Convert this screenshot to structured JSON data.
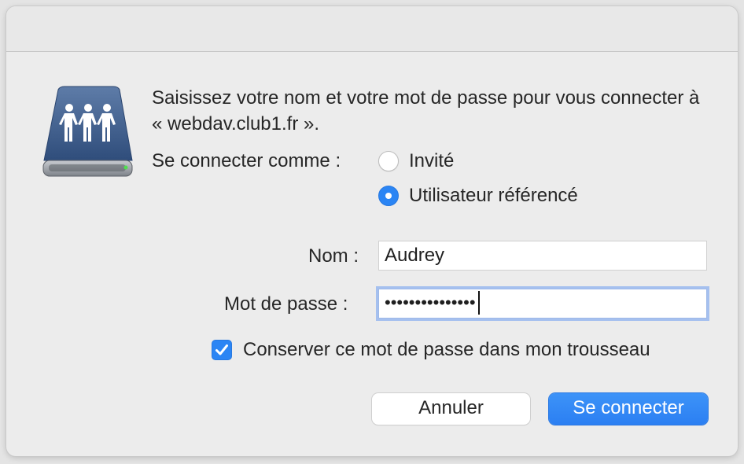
{
  "dialog": {
    "message": "Saisissez votre nom et votre mot de passe pour vous connecter à « webdav.club1.fr ».",
    "icon": "network-server-icon"
  },
  "connect_as": {
    "label": "Se connecter comme :",
    "options": [
      {
        "label": "Invité",
        "selected": false
      },
      {
        "label": "Utilisateur référencé",
        "selected": true
      }
    ]
  },
  "form": {
    "name_label": "Nom :",
    "name_value": "Audrey",
    "password_label": "Mot de passe :",
    "password_value": "•••••••••••••••",
    "keychain_label": "Conserver ce mot de passe dans mon trousseau",
    "keychain_checked": true
  },
  "buttons": {
    "cancel": "Annuler",
    "connect": "Se connecter"
  },
  "colors": {
    "accent": "#2b85f4",
    "focus_ring": "#a5c0ef"
  }
}
